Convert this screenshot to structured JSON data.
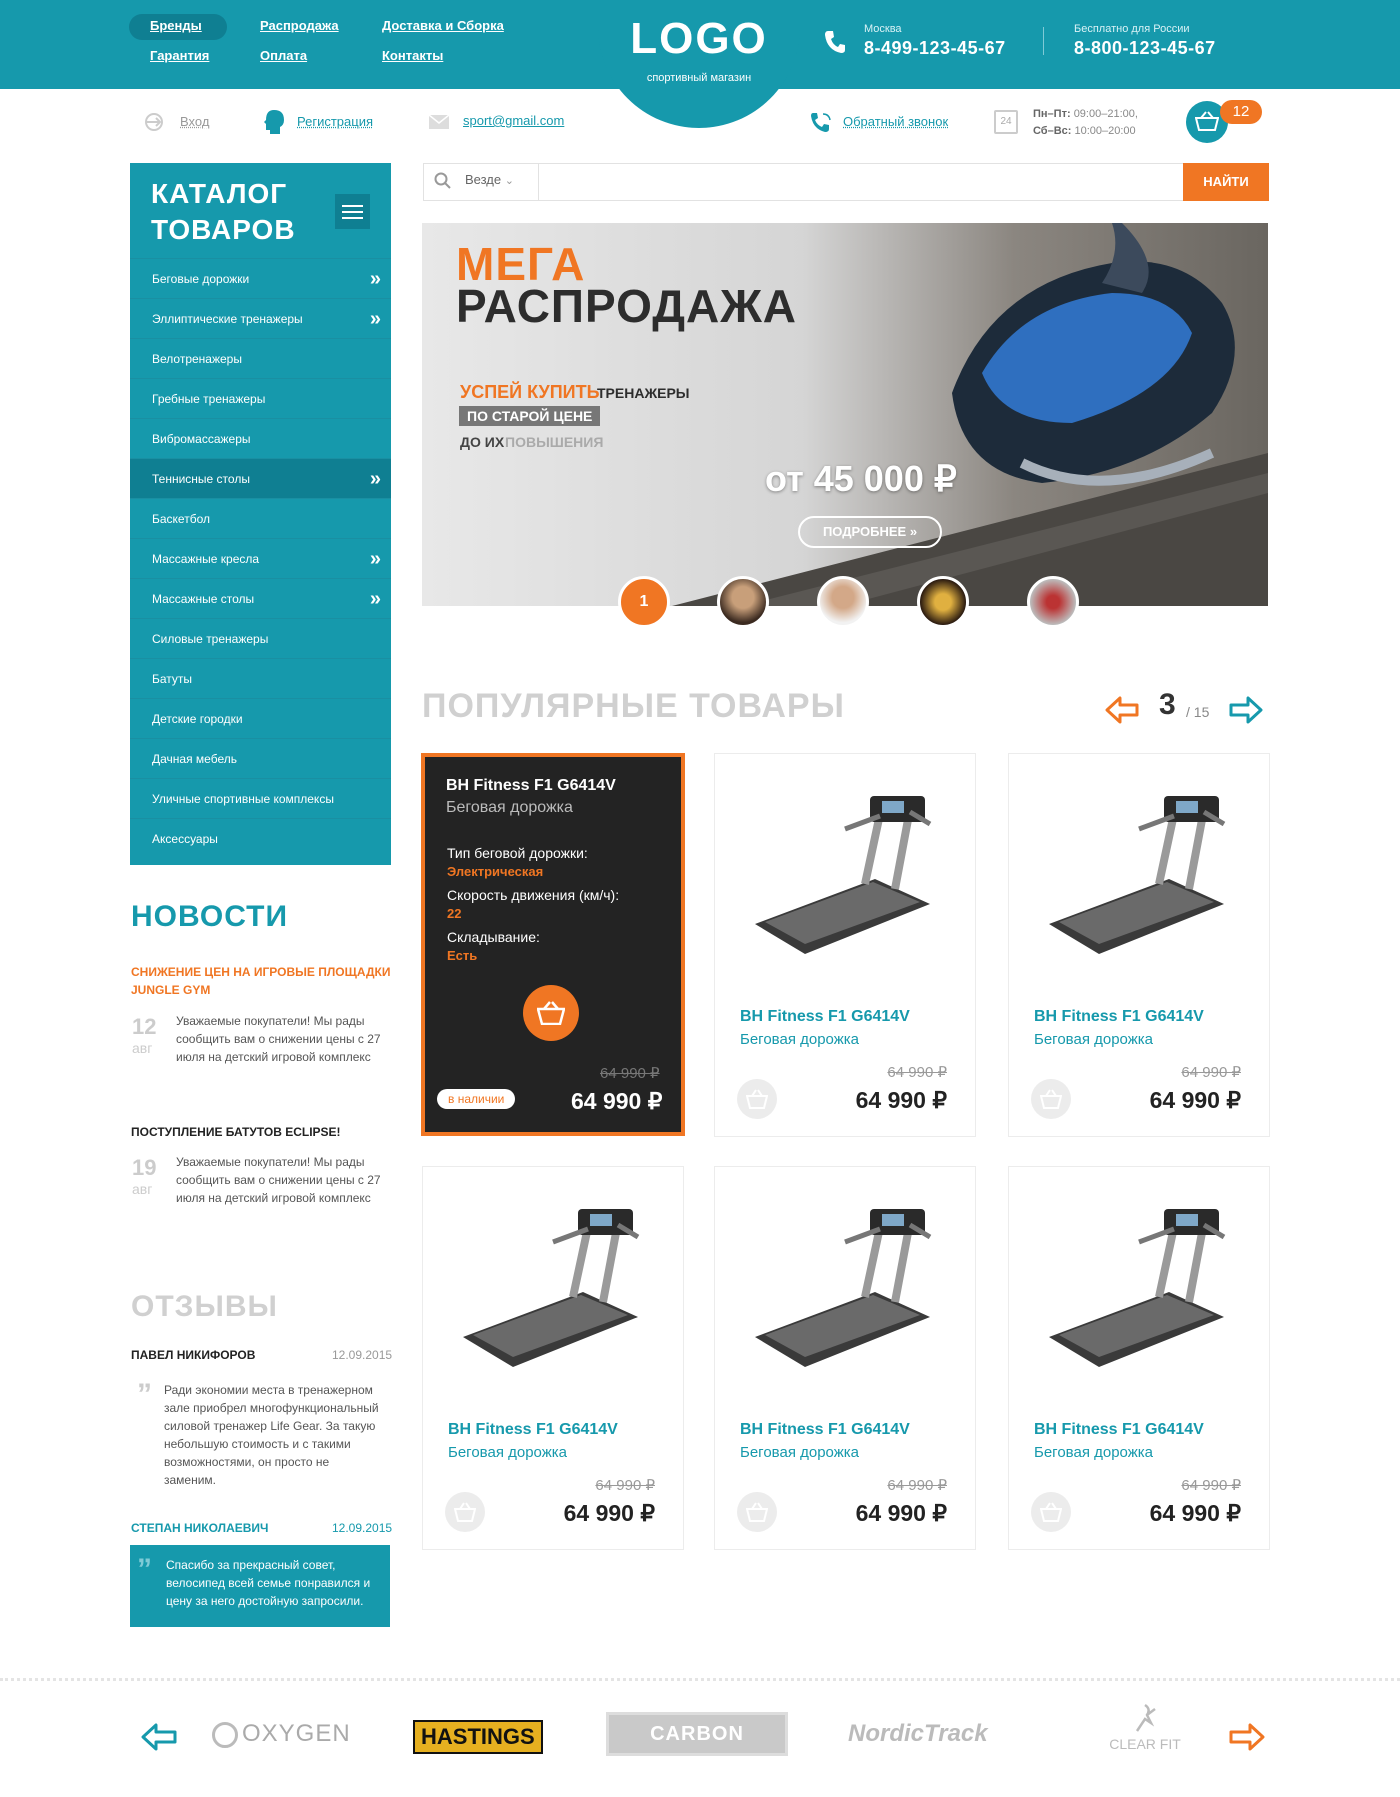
{
  "header": {
    "nav": {
      "brands": "Бренды",
      "sale": "Распродажа",
      "delivery": "Доставка и Сборка",
      "warranty": "Гарантия",
      "payment": "Оплата",
      "contacts": "Контакты"
    },
    "logo": "LOGO",
    "logo_sub": "спортивный магазин",
    "phone1": {
      "city": "Москва",
      "number": "8-499-123-45-67"
    },
    "phone2": {
      "city": "Бесплатно для России",
      "number": "8-800-123-45-67"
    }
  },
  "subheader": {
    "login": "Вход",
    "register": "Регистрация",
    "email": "sport@gmail.com",
    "callback": "Обратный звонок",
    "hours_weekday_label": "Пн–Пт:",
    "hours_weekday": "09:00–21:00,",
    "hours_weekend_label": "Сб–Вс:",
    "hours_weekend": "10:00–20:00",
    "calendar_day": "24",
    "cart_count": "12"
  },
  "catalog": {
    "title_line1": "КАТАЛОГ",
    "title_line2": "ТОВАРОВ",
    "items": [
      {
        "label": "Беговые дорожки",
        "arrow": "»"
      },
      {
        "label": "Эллиптические тренажеры",
        "arrow": "»"
      },
      {
        "label": "Велотренажеры",
        "arrow": ""
      },
      {
        "label": "Гребные тренажеры",
        "arrow": ""
      },
      {
        "label": "Вибромассажеры",
        "arrow": ""
      },
      {
        "label": "Теннисные столы",
        "arrow": "»"
      },
      {
        "label": "Баскетбол",
        "arrow": ""
      },
      {
        "label": "Массажные кресла",
        "arrow": "»"
      },
      {
        "label": "Массажные столы",
        "arrow": "»"
      },
      {
        "label": "Силовые тренажеры",
        "arrow": ""
      },
      {
        "label": "Батуты",
        "arrow": ""
      },
      {
        "label": "Детские городки",
        "arrow": ""
      },
      {
        "label": "Дачная мебель",
        "arrow": ""
      },
      {
        "label": "Уличные спортивные комплексы",
        "arrow": ""
      },
      {
        "label": "Аксессуары",
        "arrow": ""
      }
    ]
  },
  "search": {
    "scope": "Везде",
    "placeholder": "",
    "button": "НАЙТИ"
  },
  "banner": {
    "title1": "МЕГА",
    "title2": "РАСПРОДАЖА",
    "line1_accent": "УСПЕЙ КУПИТЬ",
    "line1_rest": "ТРЕНАЖЕРЫ",
    "line2": "ПО СТАРОЙ ЦЕНЕ",
    "line3": "ДО ИХ",
    "line3_rest": "ПОВЫШЕНИЯ",
    "price": "от 45 000 ₽",
    "button": "ПОДРОБНЕЕ",
    "slide_current": "1"
  },
  "popular": {
    "title": "ПОПУЛЯРНЫЕ ТОВАРЫ",
    "page_current": "3",
    "page_total": "/ 15",
    "highlight": {
      "name": "BH Fitness F1 G6414V",
      "type": "Беговая дорожка",
      "spec1_label": "Тип беговой дорожки:",
      "spec1_value": "Электрическая",
      "spec2_label": "Скорость движения (км/ч):",
      "spec2_value": "22",
      "spec3_label": "Складывание:",
      "spec3_value": "Есть",
      "stock": "в наличии",
      "old_price": "64 990 ₽",
      "price": "64 990 ₽"
    },
    "products": [
      {
        "name": "BH Fitness F1 G6414V",
        "type": "Беговая дорожка",
        "old_price": "64 990 ₽",
        "price": "64 990 ₽"
      },
      {
        "name": "BH Fitness F1 G6414V",
        "type": "Беговая дорожка",
        "old_price": "64 990 ₽",
        "price": "64 990 ₽"
      },
      {
        "name": "BH Fitness F1 G6414V",
        "type": "Беговая дорожка",
        "old_price": "64 990 ₽",
        "price": "64 990 ₽"
      },
      {
        "name": "BH Fitness F1 G6414V",
        "type": "Беговая дорожка",
        "old_price": "64 990 ₽",
        "price": "64 990 ₽"
      },
      {
        "name": "BH Fitness F1 G6414V",
        "type": "Беговая дорожка",
        "old_price": "64 990 ₽",
        "price": "64 990 ₽"
      }
    ]
  },
  "news": {
    "title": "НОВОСТИ",
    "items": [
      {
        "headline": "СНИЖЕНИЕ ЦЕН НА ИГРОВЫЕ ПЛОЩАДКИ JUNGLE GYM",
        "day": "12",
        "month": "авг",
        "text": "Уважаемые покупатели! Мы рады сообщить вам о снижении цены с 27 июля на детский игровой комплекс"
      },
      {
        "headline": "ПОСТУПЛЕНИЕ БАТУТОВ ECLIPSE!",
        "day": "19",
        "month": "авг",
        "text": "Уважаемые покупатели! Мы рады сообщить вам о снижении цены с 27 июля на детский игровой комплекс"
      }
    ]
  },
  "reviews": {
    "title": "ОТЗЫВЫ",
    "items": [
      {
        "author": "ПАВЕЛ НИКИФОРОВ",
        "date": "12.09.2015",
        "text": "Ради экономии места в тренажерном зале приобрел многофункциональный силовой тренажер Life Gear. За такую небольшую стоимость и с такими возможностями, он просто не заменим."
      },
      {
        "author": "СТЕПАН НИКОЛАЕВИЧ",
        "date": "12.09.2015",
        "text": "Спасибо за прекрасный совет, велосипед всей семье понравился и цену за него достойную запросили."
      }
    ]
  },
  "brands": [
    "OXYGEN",
    "HASTINGS",
    "CARBON",
    "NordicTrack",
    "CLEAR FIT"
  ],
  "colors": {
    "accent": "#1699ac",
    "orange": "#f07623",
    "dark": "#232323"
  }
}
